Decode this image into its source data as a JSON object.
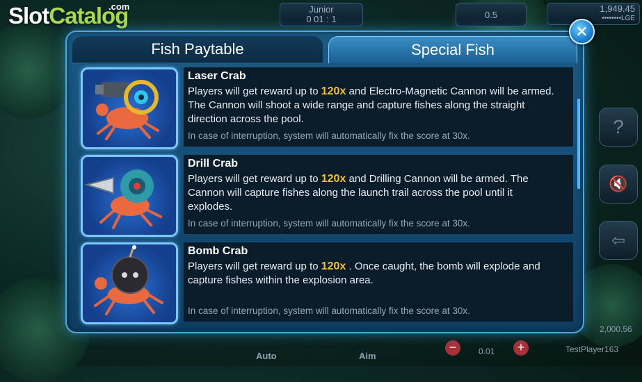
{
  "logo": {
    "part1": "Slot",
    "part2": "Catalog",
    "suffix": ".com"
  },
  "hud": {
    "player_level": "Junior",
    "timer": "0 01 : 1",
    "bet": "0.5",
    "balance": "1,949.45",
    "currency": "••••••••LGE",
    "bottom_balance": "2,000.56",
    "player_name": "TestPlayer163",
    "bet_step": "0.01",
    "auto_label": "Auto",
    "aim_label": "Aim"
  },
  "modal": {
    "tabs": [
      {
        "label": "Fish Paytable",
        "active": false
      },
      {
        "label": "Special Fish",
        "active": true
      }
    ],
    "close_symbol": "✕",
    "items": [
      {
        "name": "Laser Crab",
        "desc_before": "Players will get reward up to ",
        "multiplier": "120x",
        "desc_after": " and Electro-Magnetic Cannon will be armed. The Cannon will shoot a wide range and capture fishes along the straight direction across the pool.",
        "note": "In case of interruption, system will automatically fix the score at 30x.",
        "icon": "laser-crab-icon"
      },
      {
        "name": "Drill Crab",
        "desc_before": "Players will get reward up to ",
        "multiplier": "120x",
        "desc_after": "  and Drilling Cannon will be armed. The Cannon will capture fishes along the launch trail across the pool until it explodes.",
        "note": "In case of interruption, system will automatically fix the score at 30x.",
        "icon": "drill-crab-icon"
      },
      {
        "name": "Bomb Crab",
        "desc_before": "Players will get reward up to ",
        "multiplier": "120x",
        "desc_after": " . Once caught, the bomb will explode and capture fishes within the explosion area.",
        "note": "In case of interruption, system will automatically fix the score at 30x.",
        "icon": "bomb-crab-icon"
      }
    ]
  }
}
